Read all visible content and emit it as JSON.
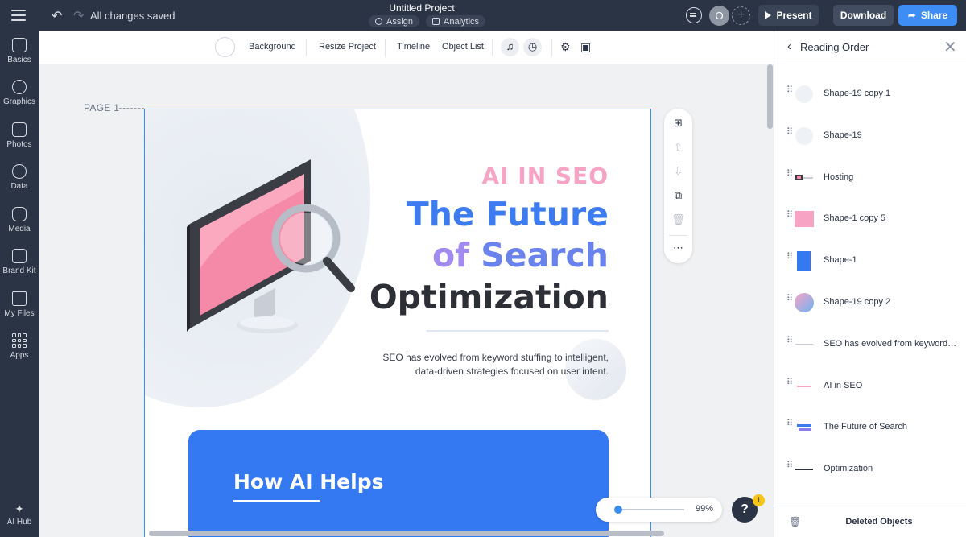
{
  "topbar": {
    "saved_status": "All changes saved",
    "project_title": "Untitled Project",
    "assign_label": "Assign",
    "analytics_label": "Analytics",
    "avatar_initial": "O",
    "present_label": "Present",
    "download_label": "Download",
    "share_label": "Share"
  },
  "leftnav": {
    "items": [
      {
        "label": "Basics",
        "icon": "basics-icon"
      },
      {
        "label": "Graphics",
        "icon": "graphics-icon"
      },
      {
        "label": "Photos",
        "icon": "photos-icon"
      },
      {
        "label": "Data",
        "icon": "data-icon"
      },
      {
        "label": "Media",
        "icon": "media-icon"
      },
      {
        "label": "Brand Kit",
        "icon": "brand-kit-icon"
      },
      {
        "label": "My Files",
        "icon": "folder-icon"
      },
      {
        "label": "Apps",
        "icon": "apps-icon"
      }
    ],
    "ai_hub_label": "AI Hub"
  },
  "toolbar": {
    "background_label": "Background",
    "resize_label": "Resize Project",
    "timeline_label": "Timeline",
    "object_list_label": "Object List"
  },
  "canvas": {
    "page_label": "PAGE 1",
    "ai_in_seo": "AI IN SEO",
    "future_line": "The Future",
    "search_of": "of",
    "search_word": "Search",
    "optimization": "Optimization",
    "description_line1": "SEO has evolved from keyword stuffing to intelligent,",
    "description_line2": "data-driven strategies focused on user intent.",
    "how_title": "How AI Helps",
    "zoom_value": "99%",
    "zoom_level": 0.99,
    "help_label": "?",
    "help_badge": "1"
  },
  "panel": {
    "title": "Reading Order",
    "items": [
      {
        "label": "Shape-19 copy 1"
      },
      {
        "label": "Shape-19"
      },
      {
        "label": "Hosting"
      },
      {
        "label": "Shape-1 copy 5"
      },
      {
        "label": "Shape-1"
      },
      {
        "label": "Shape-19 copy 2"
      },
      {
        "label": "SEO has evolved from keyword stuffing to intelligent"
      },
      {
        "label": "AI in SEO"
      },
      {
        "label": "The Future of Search"
      },
      {
        "label": "Optimization"
      }
    ],
    "deleted_label": "Deleted Objects"
  },
  "colors": {
    "accent": "#3d8df5",
    "dark": "#2b3445",
    "pink": "#f7a4c4",
    "blue": "#3d7bf0"
  }
}
